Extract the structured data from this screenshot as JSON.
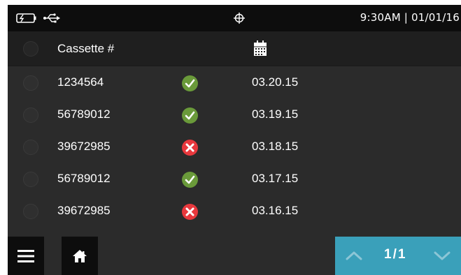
{
  "status_bar": {
    "battery_icon": "battery-icon",
    "usb_icon": "usb-icon",
    "center_icon": "crosshair-icon",
    "datetime": "9:30AM | 01/01/16"
  },
  "list": {
    "header": {
      "cassette_label": "Cassette #",
      "date_icon": "calendar-icon"
    },
    "rows": [
      {
        "cassette": "1234564",
        "status": "ok",
        "date": "03.20.15"
      },
      {
        "cassette": "56789012",
        "status": "ok",
        "date": "03.19.15"
      },
      {
        "cassette": "39672985",
        "status": "fail",
        "date": "03.18.15"
      },
      {
        "cassette": "56789012",
        "status": "ok",
        "date": "03.17.15"
      },
      {
        "cassette": "39672985",
        "status": "fail",
        "date": "03.16.15"
      }
    ]
  },
  "bottom_bar": {
    "menu_icon": "hamburger-menu-icon",
    "home_icon": "home-icon",
    "pager": "1/1"
  },
  "colors": {
    "ok": "#6a9a3a",
    "fail": "#e8383d",
    "pager_bg": "#3aa0ba",
    "bar_bg": "#0d0d0d",
    "list_bg": "#2b2b2b"
  }
}
